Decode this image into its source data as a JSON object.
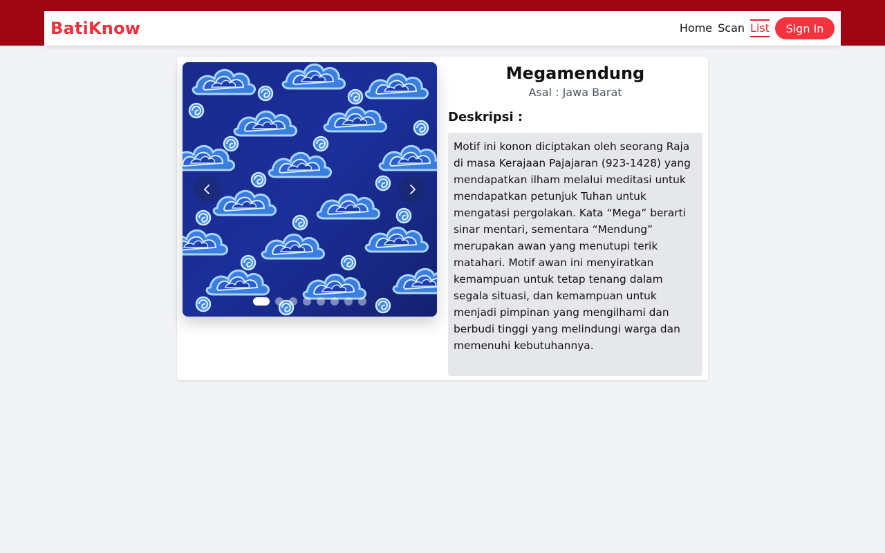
{
  "navbar": {
    "brand": "BatiKnow",
    "links": [
      {
        "label": "Home",
        "active": false
      },
      {
        "label": "Scan",
        "active": false
      },
      {
        "label": "List",
        "active": true
      }
    ],
    "signin_label": "Sign In",
    "colors": {
      "band": "#9e0614",
      "accent": "#f5333f"
    }
  },
  "carousel": {
    "image": "megamendung-batik-pattern",
    "slide_count": 8,
    "current_slide": 1,
    "prev_icon": "chevron-left-icon",
    "next_icon": "chevron-right-icon"
  },
  "detail": {
    "title": "Megamendung",
    "origin_label": "Asal : ",
    "origin_value": "Jawa Barat",
    "description_heading": "Deskripsi :",
    "description": "Motif ini konon diciptakan oleh seorang Raja di masa Kerajaan Pajajaran (923-1428) yang mendapatkan ilham melalui meditasi untuk mendapatkan petunjuk Tuhan untuk mengatasi pergolakan. Kata “Mega” berarti sinar mentari, sementara “Mendung” merupakan awan yang menutupi terik matahari. Motif awan ini menyiratkan kemampuan untuk tetap tenang dalam segala situasi, dan kemampuan untuk menjadi pimpinan yang mengilhami dan berbudi tinggi yang melindungi warga dan memenuhi kebutuhannya."
  }
}
